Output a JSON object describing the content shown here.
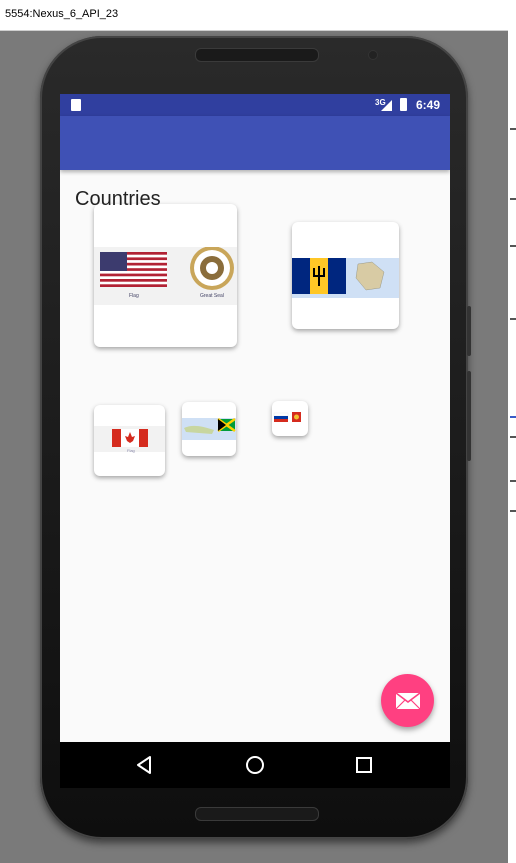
{
  "window": {
    "title": "5554:Nexus_6_API_23"
  },
  "status_bar": {
    "network_label": "3G",
    "time": "6:49"
  },
  "content": {
    "heading": "Countries"
  },
  "cards": [
    {
      "country": "United States",
      "flag_caption": "Flag",
      "seal_caption": "Great Seal"
    },
    {
      "country": "Barbados"
    },
    {
      "country": "Canada",
      "flag_caption": "Flag"
    },
    {
      "country": "Jamaica"
    },
    {
      "country": "Russia"
    }
  ],
  "fab": {
    "icon": "mail-icon"
  },
  "nav": {
    "back": "back-icon",
    "home": "home-icon",
    "recents": "recents-icon"
  },
  "colors": {
    "primary": "#3f51b5",
    "primary_dark": "#303f9f",
    "accent": "#ff4081"
  }
}
